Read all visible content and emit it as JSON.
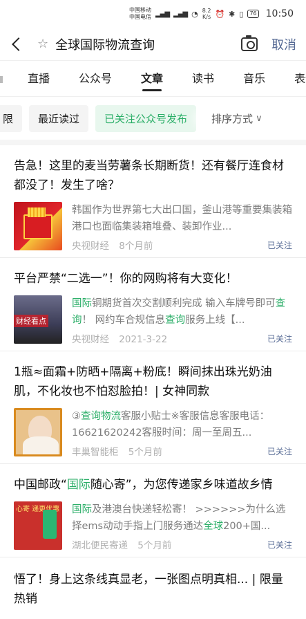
{
  "status": {
    "carrier1": "中国移动",
    "carrier2": "中国电信",
    "speed_value": "8.2",
    "speed_unit": "K/s",
    "battery": "76",
    "time": "10:50"
  },
  "search": {
    "query": "全球国际物流查询",
    "cancel_label": "取消"
  },
  "tabs": [
    "直播",
    "公众号",
    "文章",
    "读书",
    "音乐",
    "表情"
  ],
  "active_tab": "文章",
  "filters": {
    "chip_cut": "限",
    "chip_recent": "最近读过",
    "chip_followed": "已关注公众号发布",
    "sort_label": "排序方式"
  },
  "articles": [
    {
      "title": "告急！这里的麦当劳薯条长期断货！还有餐厅连食材都没了！发生了啥？",
      "snippet": "韩国作为世界第七大出口国，釜山港等重要集装箱港口也面临集装箱堆叠、装卸作业...",
      "source": "央视财经",
      "time": "8个月前",
      "followed": "已关注"
    },
    {
      "title": "平台严禁“二选一”！你的网购将有大变化！",
      "snippet_parts": [
        "国际",
        "铜期货首次交割顺利完成 输入车牌号即可",
        "查询",
        "！ 网约车合规信息",
        "查询",
        "服务上线【..."
      ],
      "thumb_label": "财经看点",
      "source": "央视财经",
      "time": "2021-3-22",
      "followed": "已关注"
    },
    {
      "title": "1瓶≈面霜+防晒+隔离+粉底！瞬间抹出珠光奶油肌，不化妆也不怕怼脸拍！| 女神同款",
      "snippet_parts": [
        "③",
        "查询物流",
        "客服小贴士※客服信息客服电话：16621620242客服时间：周一至周五..."
      ],
      "source": "丰巢智能柜",
      "time": "5个月前",
      "followed": "已关注"
    },
    {
      "title_parts": [
        "中国邮政“",
        "国际",
        "随心寄”，为您传递家乡味道故乡情"
      ],
      "snippet_parts": [
        "国际",
        "及港澳台快递轻松寄！ >>>>>>为什么选择ems动动手指上门服务通达",
        "全球",
        "200+国..."
      ],
      "thumb_label": "心寄 递更优惠",
      "source": "湖北便民寄递",
      "time": "5个月前",
      "followed": "已关注"
    }
  ],
  "last_article_title": "悟了！身上这条线真显老，一张图点明真相... | 限量热销"
}
